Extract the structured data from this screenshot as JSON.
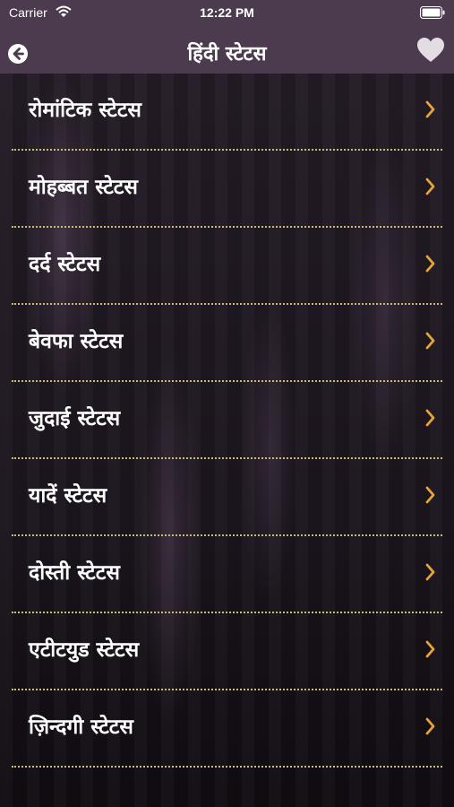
{
  "status_bar": {
    "carrier": "Carrier",
    "time": "12:22 PM"
  },
  "nav_bar": {
    "title": "हिंदी स्टेटस",
    "back_icon": "back-arrow-circle-icon",
    "favorite_icon": "heart-icon"
  },
  "list": {
    "items": [
      {
        "label": "रोमांटिक स्टेटस"
      },
      {
        "label": "मोहब्बत स्टेटस"
      },
      {
        "label": "दर्द स्टेटस"
      },
      {
        "label": "बेवफा स्टेटस"
      },
      {
        "label": "जुदाई स्टेटस"
      },
      {
        "label": "यादें स्टेटस"
      },
      {
        "label": "दोस्ती स्टेटस"
      },
      {
        "label": "एटीटयुड स्टेटस"
      },
      {
        "label": "ज़िन्दगी स्टेटस"
      }
    ]
  },
  "colors": {
    "nav_background": "#4c3a4f",
    "chevron": "#e7a43a",
    "separator": "#c9bb7a",
    "text": "#ffffff"
  }
}
